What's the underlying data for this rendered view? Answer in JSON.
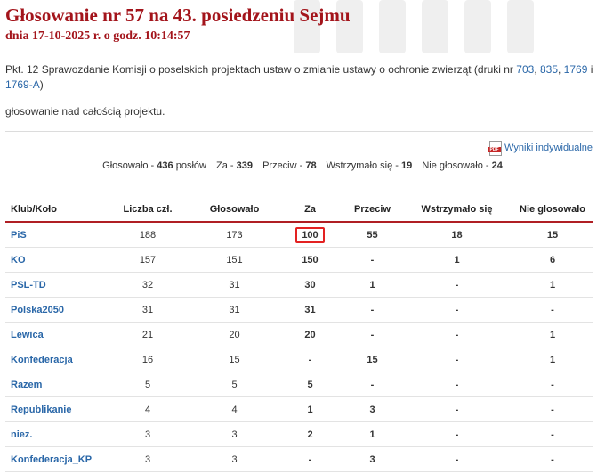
{
  "header": {
    "title": "Głosowanie nr 57 na 43. posiedzeniu Sejmu",
    "subtitle": "dnia 17-10-2025 r. o godz. 10:14:57"
  },
  "description": {
    "text_before": "Pkt. 12 Sprawozdanie Komisji o poselskich projektach ustaw o zmianie ustawy o ochronie zwierząt (druki nr ",
    "links": [
      "703",
      "835",
      "1769",
      "1769-A"
    ],
    "separators": [
      ", ",
      ", ",
      " i "
    ],
    "text_after": ")"
  },
  "vote_scope": "głosowanie nad całością projektu.",
  "individual_results_link": "Wyniki indywidualne",
  "pdf_icon_text": "PDF",
  "summary": {
    "voted_label": "Głosowało -",
    "voted_value": "436",
    "voted_unit": "posłów",
    "for_label": "Za -",
    "for_value": "339",
    "against_label": "Przeciw -",
    "against_value": "78",
    "abstained_label": "Wstrzymało się -",
    "abstained_value": "19",
    "not_voted_label": "Nie głosowało -",
    "not_voted_value": "24"
  },
  "table": {
    "headers": [
      "Klub/Koło",
      "Liczba czł.",
      "Głosowało",
      "Za",
      "Przeciw",
      "Wstrzymało się",
      "Nie głosowało"
    ],
    "rows": [
      {
        "club": "PiS",
        "members": "188",
        "voted": "173",
        "for": "100",
        "against": "55",
        "abstained": "18",
        "not_voted": "15"
      },
      {
        "club": "KO",
        "members": "157",
        "voted": "151",
        "for": "150",
        "against": "-",
        "abstained": "1",
        "not_voted": "6"
      },
      {
        "club": "PSL-TD",
        "members": "32",
        "voted": "31",
        "for": "30",
        "against": "1",
        "abstained": "-",
        "not_voted": "1"
      },
      {
        "club": "Polska2050",
        "members": "31",
        "voted": "31",
        "for": "31",
        "against": "-",
        "abstained": "-",
        "not_voted": "-"
      },
      {
        "club": "Lewica",
        "members": "21",
        "voted": "20",
        "for": "20",
        "against": "-",
        "abstained": "-",
        "not_voted": "1"
      },
      {
        "club": "Konfederacja",
        "members": "16",
        "voted": "15",
        "for": "-",
        "against": "15",
        "abstained": "-",
        "not_voted": "1"
      },
      {
        "club": "Razem",
        "members": "5",
        "voted": "5",
        "for": "5",
        "against": "-",
        "abstained": "-",
        "not_voted": "-"
      },
      {
        "club": "Republikanie",
        "members": "4",
        "voted": "4",
        "for": "1",
        "against": "3",
        "abstained": "-",
        "not_voted": "-"
      },
      {
        "club": "niez.",
        "members": "3",
        "voted": "3",
        "for": "2",
        "against": "1",
        "abstained": "-",
        "not_voted": "-"
      },
      {
        "club": "Konfederacja_KP",
        "members": "3",
        "voted": "3",
        "for": "-",
        "against": "3",
        "abstained": "-",
        "not_voted": "-"
      }
    ]
  },
  "colors": {
    "title": "#a3141b",
    "link": "#2a67a8",
    "header_rule": "#b01f24",
    "highlight_box": "#e32222"
  }
}
